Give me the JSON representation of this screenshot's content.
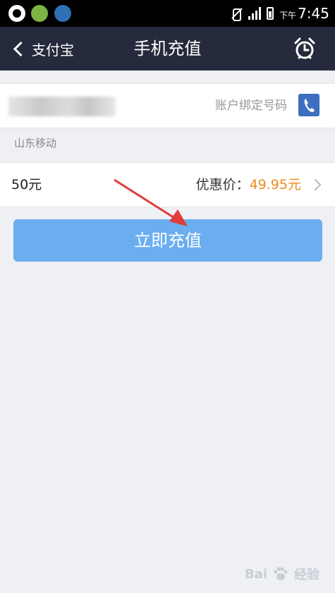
{
  "status_bar": {
    "ampm": "下午",
    "time": "7:45",
    "icons": [
      "qq-icon",
      "message-icon",
      "browser-icon",
      "mute-icon",
      "signal-icon",
      "battery-icon"
    ]
  },
  "nav": {
    "back_label": "支付宝",
    "title": "手机充值",
    "right_icon": "alarm-clock-icon"
  },
  "phone": {
    "value": "",
    "bind_label": "账户绑定号码",
    "contacts_icon": "phone-icon"
  },
  "carrier": "山东移动",
  "amount": {
    "value": "50元",
    "discount_label": "优惠价：",
    "discount_price": "49.95元"
  },
  "action": {
    "button_label": "立即充值"
  },
  "watermark": {
    "text": "Bai",
    "suffix": "经验"
  },
  "colors": {
    "nav_bg": "#252a3c",
    "button": "#6aaef0",
    "price": "#f08a1e",
    "arrow": "#e23b3b",
    "page_bg": "#eef0f3"
  }
}
